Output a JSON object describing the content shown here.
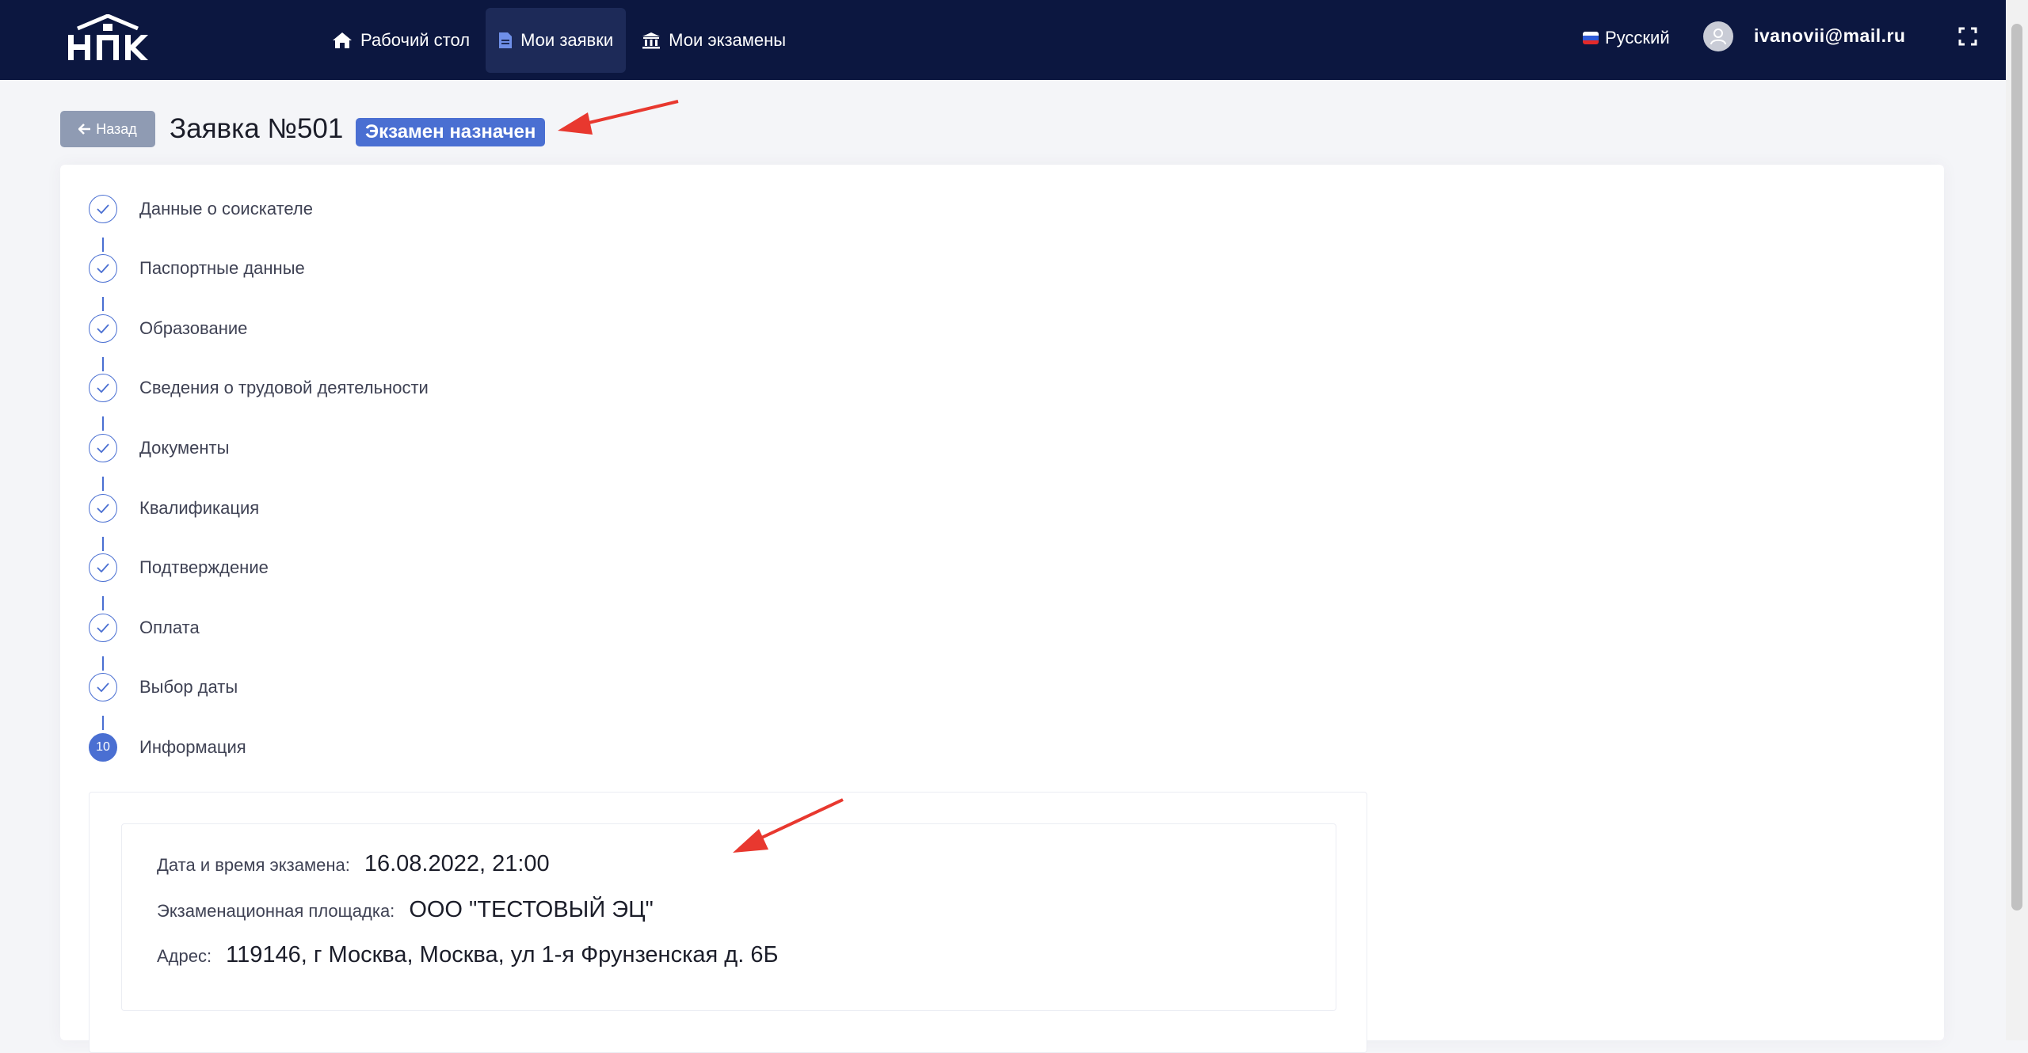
{
  "topbar": {
    "logo_alt": "НПК",
    "nav": [
      {
        "label": "Рабочий стол",
        "icon": "home-icon",
        "active": false
      },
      {
        "label": "Мои заявки",
        "icon": "document-icon",
        "active": true
      },
      {
        "label": "Мои экзамены",
        "icon": "bank-icon",
        "active": false
      }
    ],
    "language": "Русский",
    "user_email": "ivanovii@mail.ru"
  },
  "header": {
    "back_label": "Назад",
    "title": "Заявка №501",
    "status": "Экзамен назначен"
  },
  "steps": [
    {
      "label": "Данные о соискателе",
      "state": "done"
    },
    {
      "label": "Паспортные данные",
      "state": "done"
    },
    {
      "label": "Образование",
      "state": "done"
    },
    {
      "label": "Сведения о трудовой деятельности",
      "state": "done"
    },
    {
      "label": "Документы",
      "state": "done"
    },
    {
      "label": "Квалификация",
      "state": "done"
    },
    {
      "label": "Подтверждение",
      "state": "done"
    },
    {
      "label": "Оплата",
      "state": "done"
    },
    {
      "label": "Выбор даты",
      "state": "done"
    },
    {
      "label": "Информация",
      "state": "current",
      "number": "10"
    }
  ],
  "info": {
    "datetime_label": "Дата и время экзамена:",
    "datetime_value": "16.08.2022, 21:00",
    "venue_label": "Экзаменационная площадка:",
    "venue_value": "ООО \"ТЕСТОВЫЙ ЭЦ\"",
    "address_label": "Адрес:",
    "address_value": "119146, г Москва, Москва, ул 1-я Фрунзенская д. 6Б"
  },
  "colors": {
    "topbar": "#0c1740",
    "accent": "#4a6fd2",
    "back_button": "#8f9bb3",
    "annotation": "#e8382f"
  }
}
